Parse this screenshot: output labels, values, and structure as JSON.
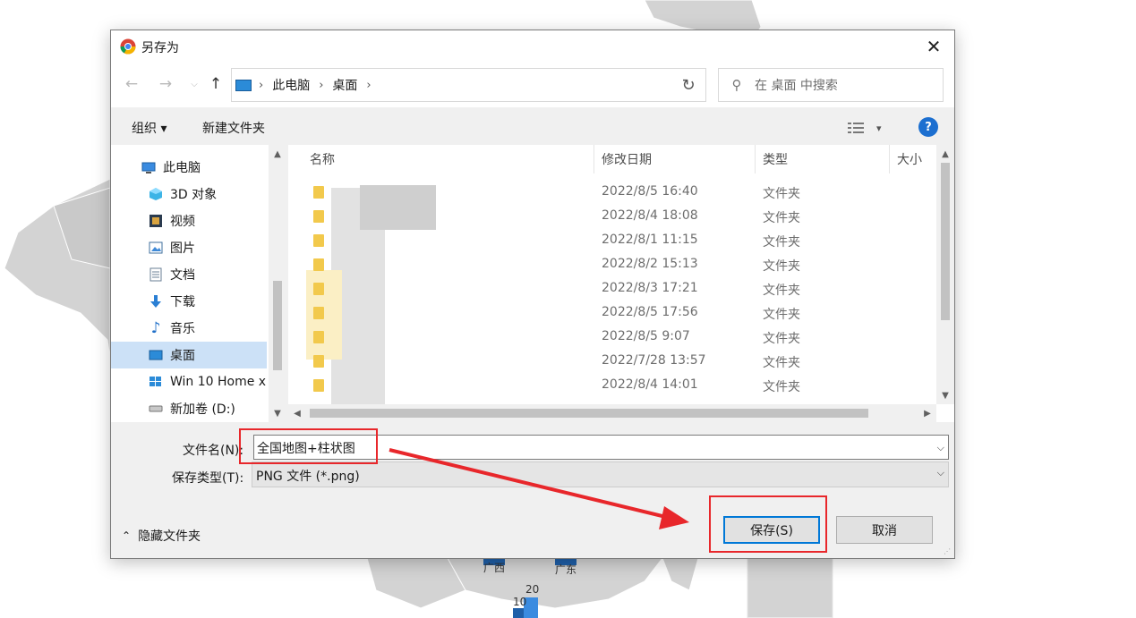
{
  "window": {
    "title": "另存为"
  },
  "address": {
    "crumbs": [
      "此电脑",
      "桌面"
    ],
    "separator": "›"
  },
  "search": {
    "placeholder": "在 桌面 中搜索"
  },
  "toolbar": {
    "organize": "组织 ▾",
    "new_folder": "新建文件夹",
    "help": "?"
  },
  "nav_pane": {
    "items": [
      {
        "label": "此电脑",
        "icon": "pc-icon"
      },
      {
        "label": "3D 对象",
        "icon": "3d-objects-icon"
      },
      {
        "label": "视频",
        "icon": "video-icon"
      },
      {
        "label": "图片",
        "icon": "pictures-icon"
      },
      {
        "label": "文档",
        "icon": "documents-icon"
      },
      {
        "label": "下载",
        "icon": "download-icon"
      },
      {
        "label": "音乐",
        "icon": "music-icon"
      },
      {
        "label": "桌面",
        "icon": "desktop-icon",
        "selected": true
      },
      {
        "label": "Win 10 Home x",
        "icon": "windows-drive-icon"
      },
      {
        "label": "新加卷 (D:)",
        "icon": "drive-icon"
      }
    ]
  },
  "file_list": {
    "columns": [
      "名称",
      "修改日期",
      "类型",
      "大小"
    ],
    "rows": [
      {
        "date": "2022/8/5 16:40",
        "type": "文件夹"
      },
      {
        "date": "2022/8/4 18:08",
        "type": "文件夹"
      },
      {
        "date": "2022/8/1 11:15",
        "type": "文件夹"
      },
      {
        "date": "2022/8/2 15:13",
        "type": "文件夹"
      },
      {
        "date": "2022/8/3 17:21",
        "type": "文件夹"
      },
      {
        "date": "2022/8/5 17:56",
        "type": "文件夹"
      },
      {
        "date": "2022/8/5 9:07",
        "type": "文件夹"
      },
      {
        "date": "2022/7/28 13:57",
        "type": "文件夹"
      },
      {
        "date": "2022/8/4 14:01",
        "type": "文件夹"
      }
    ]
  },
  "form": {
    "filename_label": "文件名(N):",
    "filename_value": "全国地图+柱状图",
    "filetype_label": "保存类型(T):",
    "filetype_value": "PNG 文件 (*.png)"
  },
  "footer": {
    "hide_folders": "隐藏文件夹",
    "save": "保存(S)",
    "cancel": "取消"
  },
  "background_map": {
    "labels": [
      "广西",
      "广东",
      "20",
      "10"
    ]
  },
  "colors": {
    "accent": "#0078d7",
    "annotation_red": "#e8272b",
    "map_gray": "#d3d3d3",
    "bar_blue": "#3a8be0"
  }
}
